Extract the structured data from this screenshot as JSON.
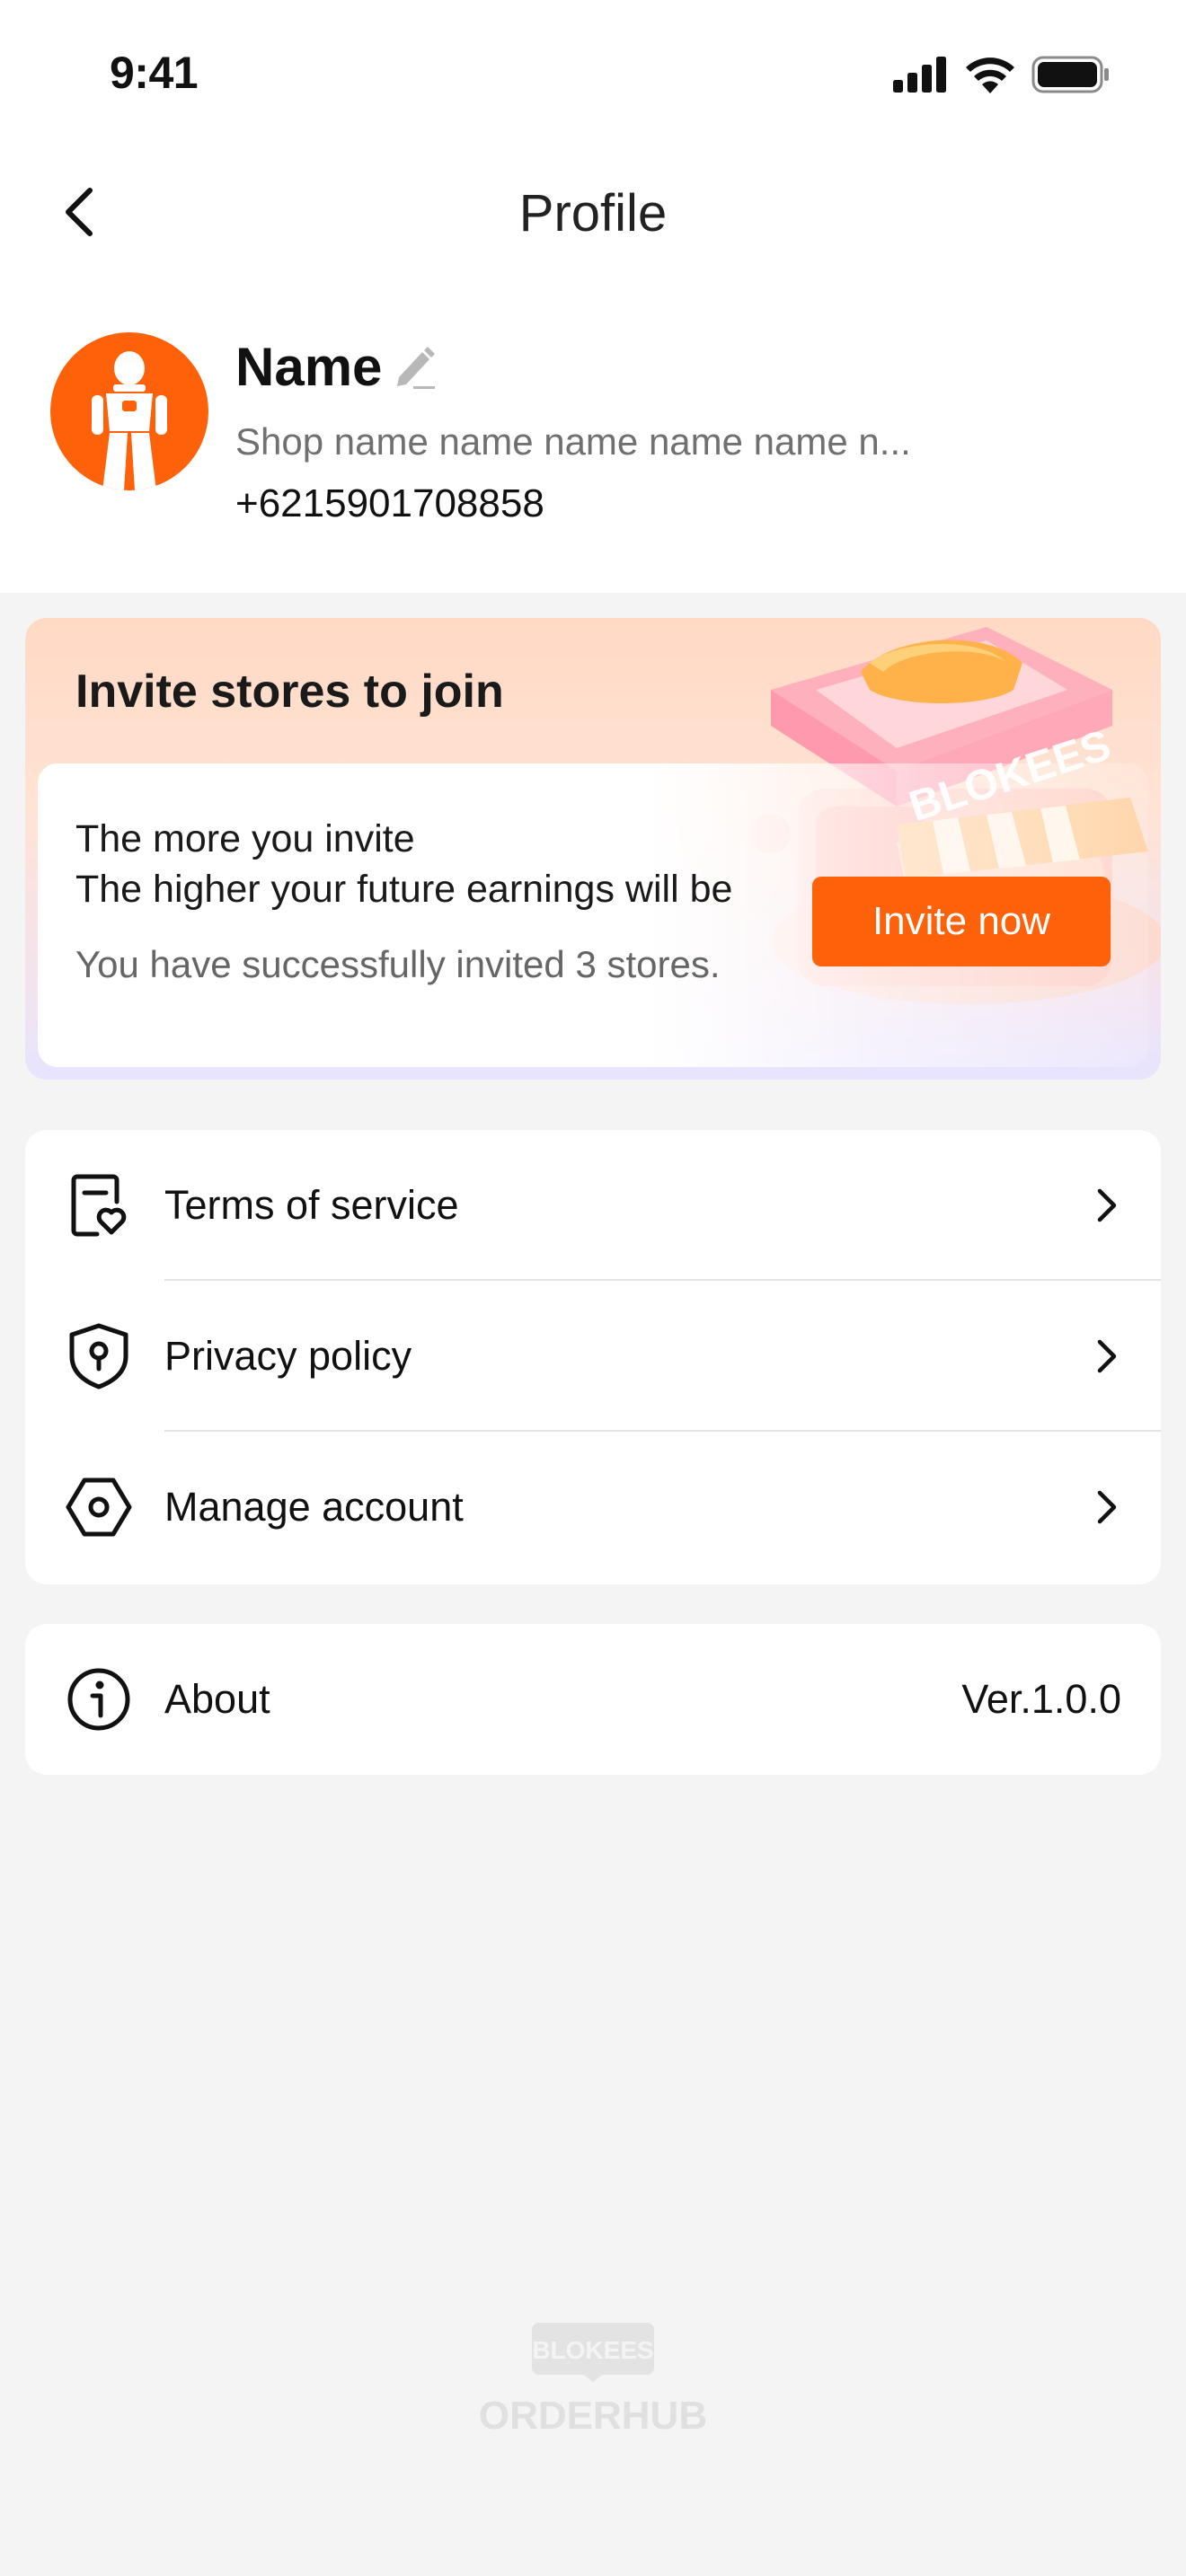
{
  "status_bar": {
    "time": "9:41"
  },
  "header": {
    "title": "Profile"
  },
  "profile": {
    "name": "Name",
    "shop_name": "Shop name name name name name n...",
    "phone": "+6215901708858"
  },
  "invite": {
    "title": "Invite stores to join",
    "line1": "The more you invite",
    "line2": "The higher your future earnings will be",
    "invited_text": "You have successfully invited 3 stores.",
    "button_label": "Invite now",
    "illustration_brand": "BLOKEES"
  },
  "menu": {
    "items": [
      {
        "label": "Terms of service",
        "icon": "document-heart-icon"
      },
      {
        "label": "Privacy policy",
        "icon": "shield-keyhole-icon"
      },
      {
        "label": "Manage account",
        "icon": "hexagon-settings-icon"
      }
    ]
  },
  "about": {
    "label": "About",
    "version": "Ver.1.0.0",
    "icon": "info-icon"
  },
  "footer": {
    "brand_top": "BLOKEES",
    "brand_bottom": "ORDERHUB"
  },
  "colors": {
    "accent": "#fd620b",
    "background": "#f4f4f4",
    "card": "#ffffff"
  }
}
